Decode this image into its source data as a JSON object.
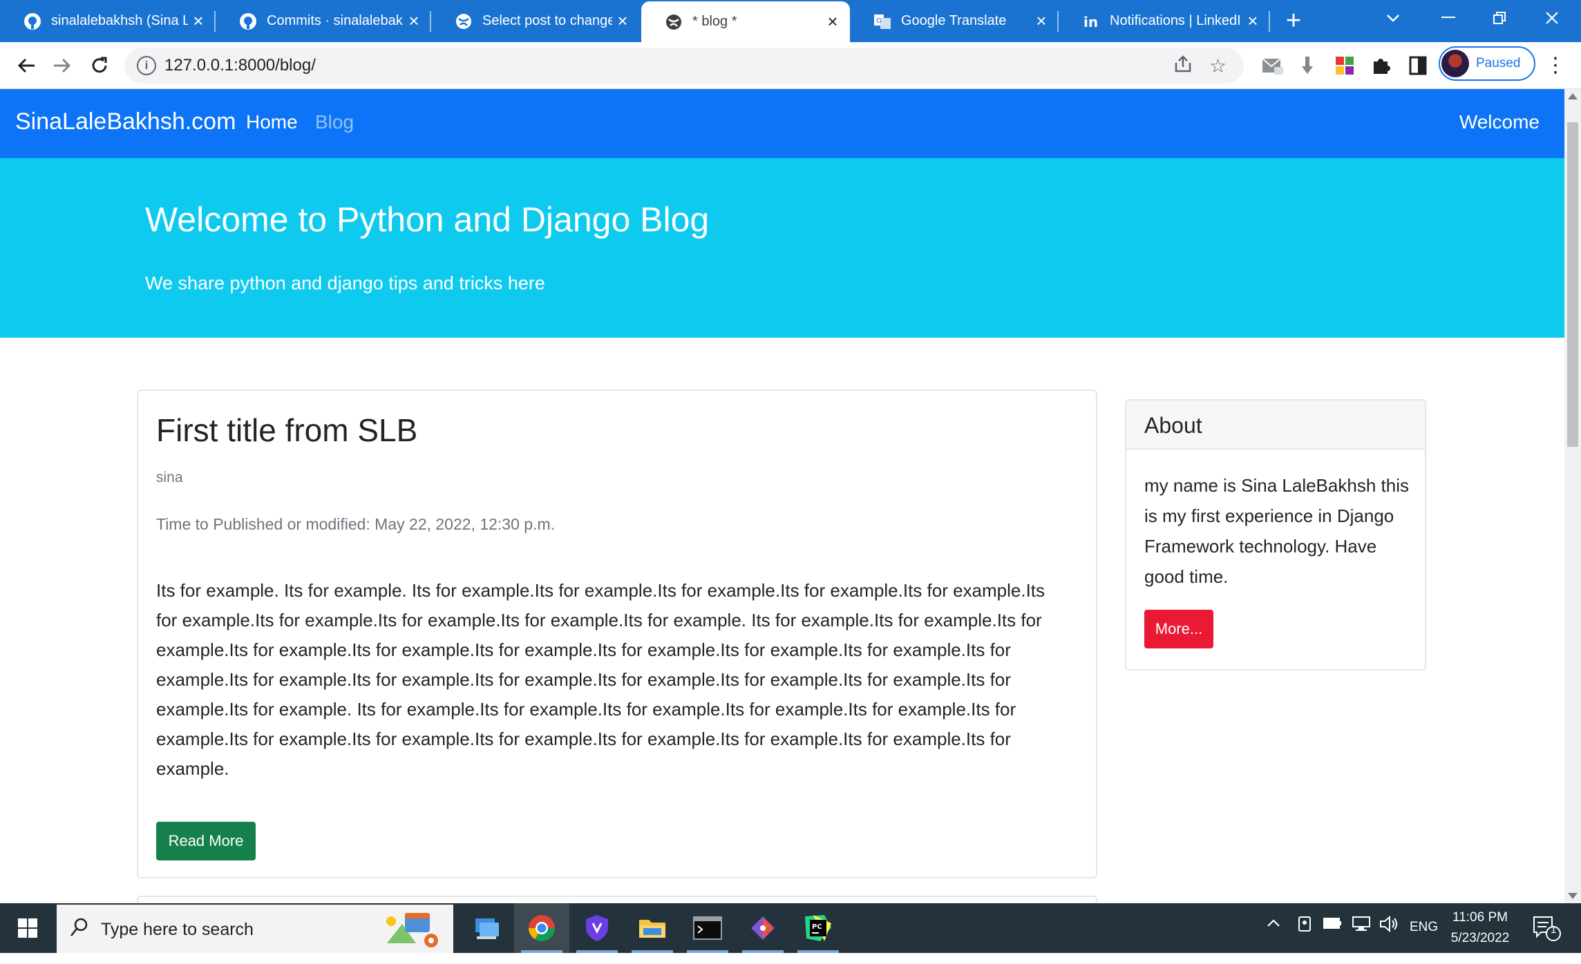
{
  "browser": {
    "tabs": [
      {
        "title": "sinalalebakhsh (Sina L",
        "icon": "github-icon",
        "active": false
      },
      {
        "title": "Commits · sinalalebakl",
        "icon": "github-icon",
        "active": false
      },
      {
        "title": "Select post to change",
        "icon": "globe-icon",
        "active": false
      },
      {
        "title": "* blog *",
        "icon": "globe-icon",
        "active": true
      },
      {
        "title": "Google Translate",
        "icon": "translate-icon",
        "active": false
      },
      {
        "title": "Notifications | LinkedI",
        "icon": "linkedin-icon",
        "active": false
      }
    ],
    "new_tab_symbol": "+",
    "url": "127.0.0.1:8000/blog/",
    "profile_status": "Paused"
  },
  "site": {
    "brand": "SinaLaleBakhsh.com",
    "nav": {
      "home": "Home",
      "blog": "Blog",
      "welcome": "Welcome"
    },
    "masthead": {
      "title": "Welcome to Python and Django Blog",
      "subtitle": "We share python and django tips and tricks here"
    },
    "post": {
      "title": "First title from SLB",
      "author": "sina",
      "time": "Time to Published or modified: May 22, 2022, 12:30 p.m.",
      "body": "Its for example. Its for example. Its for example.Its for example.Its for example.Its for example.Its for example.Its for example.Its for example.Its for example.Its for example.Its for example. Its for example.Its for example.Its for example.Its for example.Its for example.Its for example.Its for example.Its for example.Its for example.Its for example.Its for example.Its for example.Its for example.Its for example.Its for example.Its for example.Its for example.Its for example. Its for example.Its for example.Its for example.Its for example.Its for example.Its for example.Its for example.Its for example.Its for example.Its for example.Its for example.Its for example.Its for example.",
      "read_more": "Read More"
    },
    "about": {
      "heading": "About",
      "text": "my name is Sina LaleBakhsh this is my first experience in Django Framework technology. Have good time.",
      "more": "More..."
    }
  },
  "taskbar": {
    "search_placeholder": "Type here to search",
    "language": "ENG",
    "time": "11:06 PM",
    "date": "5/23/2022",
    "notification_count": "1",
    "apps": [
      "file-explorer-icon",
      "chrome-icon",
      "shield-app-icon",
      "folder-icon",
      "terminal-icon",
      "git-icon",
      "pycharm-icon"
    ]
  },
  "colors": {
    "tab_bar": "#1a73d1",
    "site_nav": "#0d74f7",
    "masthead": "#0fcaef",
    "read_more": "#16804c",
    "more_button": "#ea1a34",
    "taskbar": "#23323b"
  }
}
